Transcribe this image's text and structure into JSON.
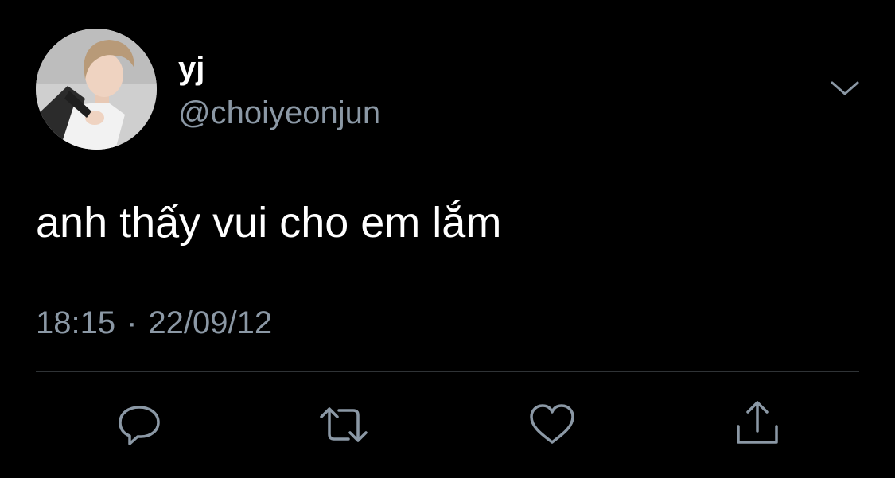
{
  "user": {
    "display_name": "yj",
    "handle": "@choiyeonjun"
  },
  "tweet": {
    "text": "anh thấy vui cho em lắm",
    "time": "18:15",
    "separator": "·",
    "date": "22/09/12"
  },
  "icons": {
    "more": "chevron-down-icon",
    "reply": "reply-icon",
    "retweet": "retweet-icon",
    "like": "heart-icon",
    "share": "share-icon"
  },
  "colors": {
    "background": "#000000",
    "primary_text": "#ffffff",
    "secondary_text": "#8b98a5",
    "icon": "#8b98a5",
    "divider": "#2f3336"
  }
}
